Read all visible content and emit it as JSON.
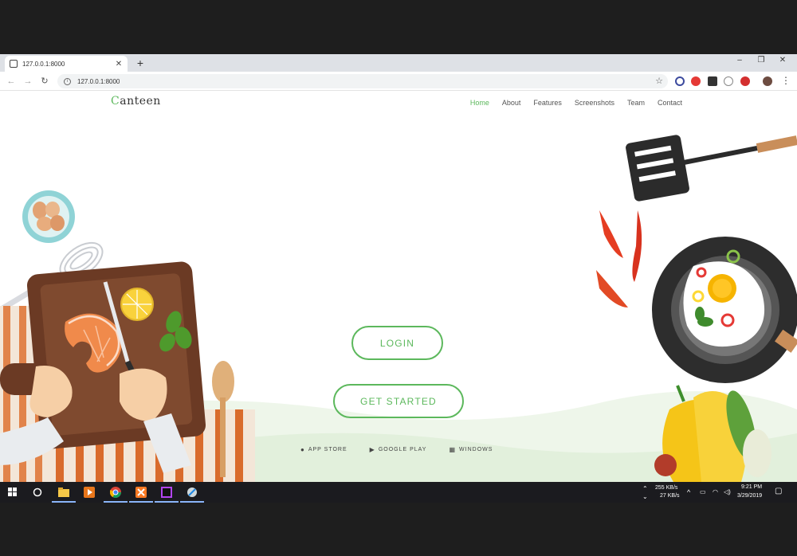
{
  "browser": {
    "tab_title": "127.0.0.1:8000",
    "new_tab": "+",
    "address": "127.0.0.1:8000",
    "win_min": "–",
    "win_max": "❐",
    "win_close": "✕"
  },
  "site": {
    "logo_first": "C",
    "logo_rest": "anteen",
    "nav": [
      "Home",
      "About",
      "Features",
      "Screenshots",
      "Team",
      "Contact"
    ],
    "login_label": "LOGIN",
    "get_started_label": "GET STARTED",
    "stores": [
      "APP STORE",
      "GOOGLE PLAY",
      "WINDOWS"
    ]
  },
  "taskbar": {
    "net_up": "255 KB/s",
    "net_down": "27 KB/s",
    "time": "9:21 PM",
    "date": "3/29/2019"
  },
  "colors": {
    "accent": "#5cb85c",
    "taskbar": "#1b1b1f"
  }
}
